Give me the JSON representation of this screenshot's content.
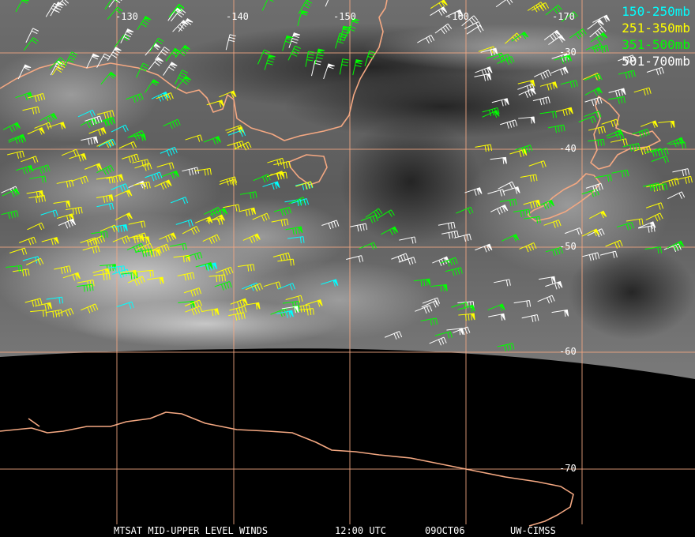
{
  "map": {
    "longitude_labels": [
      "-130",
      "-140",
      "-150",
      "-160",
      "-170"
    ],
    "latitude_labels": [
      "-30",
      "-40",
      "-50",
      "-60",
      "-70"
    ],
    "colors": {
      "grid": "#f4a882",
      "coast": "#f4a882",
      "earth_background": "#000000",
      "cloud_bright": "#c8c8c8"
    }
  },
  "legend": [
    {
      "label": "150-250mb",
      "color": "#00ffff"
    },
    {
      "label": "251-350mb",
      "color": "#ffff00"
    },
    {
      "label": "351-500mb",
      "color": "#00ff00"
    },
    {
      "label": "501-700mb",
      "color": "#ffffff"
    }
  ],
  "footer": {
    "title": "MTSAT MID-UPPER LEVEL WINDS",
    "time": "12:00 UTC",
    "date": "09OCT06",
    "source": "UW-CIMSS"
  }
}
